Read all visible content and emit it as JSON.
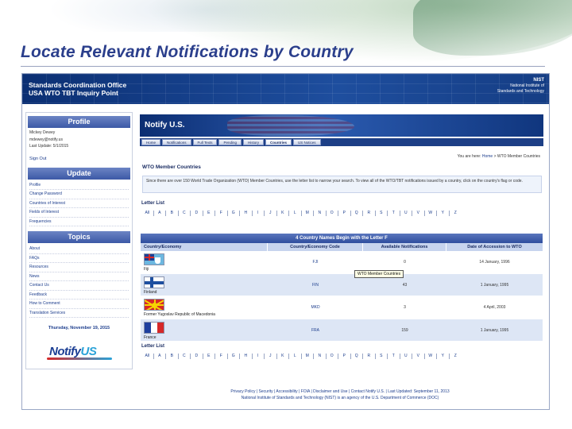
{
  "slide": {
    "title": "Locate Relevant Notifications by Country"
  },
  "banner": {
    "title_line1": "Standards Coordination Office",
    "title_line2": "USA WTO TBT Inquiry Point",
    "nist_mark": "NIST",
    "nist_line1": "National Institute of",
    "nist_line2": "Standards and Technology"
  },
  "sidebar": {
    "profile_heading": "Profile",
    "profile_lines": [
      "Mickey Dewey",
      "mdewey@notify.us",
      "Last Update: 5/1/2015"
    ],
    "signout": "Sign Out",
    "update_heading": "Update",
    "update_links": [
      "Profile",
      "Change Password",
      "Countries of Interest",
      "Fields of Interest",
      "Frequencies"
    ],
    "topics_heading": "Topics",
    "topics_links": [
      "About",
      "FAQs",
      "Resources",
      "News",
      "Contact Us",
      "Feedback",
      "How to Comment",
      "Translation Services"
    ],
    "date": "Thursday, November 19, 2015",
    "logo_main": "Notify",
    "logo_accent": "US"
  },
  "main": {
    "header_title": "Notify U.S.",
    "tabs": [
      "Home",
      "Notifications",
      "Full Texts",
      "Pending",
      "History",
      "Countries",
      "US Notices"
    ],
    "active_tab": "Countries",
    "breadcrumb_prefix": "You are here:",
    "breadcrumb_home": "Home",
    "breadcrumb_current": "WTO Member Countries",
    "section_title": "WTO Member Countries",
    "intro": "Since there are over 150 World Trade Organization (WTO) Member Countries, use the letter list to narrow your search. To view all of the WTO/TBT notifications issued by a country, click on the country's flag or code.",
    "letter_list_title": "Letter List",
    "letters": [
      "All",
      "A",
      "B",
      "C",
      "D",
      "E",
      "F",
      "G",
      "H",
      "I",
      "J",
      "K",
      "L",
      "M",
      "N",
      "O",
      "P",
      "Q",
      "R",
      "S",
      "T",
      "U",
      "V",
      "W",
      "Y",
      "Z"
    ],
    "table": {
      "heading": "4 Country Names Begin with the Letter F",
      "columns": [
        "Country/Economy",
        "Country/Economy Code",
        "Available Notifications",
        "Date of Accession to WTO"
      ],
      "tooltip": "WTO Member Countries",
      "rows": [
        {
          "country": "Fiji",
          "code": "FJI",
          "notifications": "0",
          "date": "14 January, 1996",
          "flag": "fiji"
        },
        {
          "country": "Finland",
          "code": "FIN",
          "notifications": "43",
          "date": "1 January, 1995",
          "flag": "finland"
        },
        {
          "country": "Former Yugoslav Republic of Macedonia",
          "code": "MKD",
          "notifications": "3",
          "date": "4 April, 2003",
          "flag": "macedonia"
        },
        {
          "country": "France",
          "code": "FRA",
          "notifications": "159",
          "date": "1 January, 1995",
          "flag": "france"
        }
      ]
    }
  },
  "footer": {
    "line1": "Privacy Policy | Security | Accessibility | FOIA | Disclaimer and Use | Contact Notify U.S. | Last Updated: September 11, 2013",
    "line2": "National Institute of Standards and Technology (NIST) is an agency of the U.S. Department of Commerce (DOC)"
  },
  "colors": {
    "title_blue": "#2b3f8c",
    "banner_navy": "#0b2f73",
    "link_blue": "#1b3c8c",
    "row_alt": "#dde6f5",
    "france_blue": "#1e3f9e",
    "france_white": "#ffffff",
    "france_red": "#d62828"
  }
}
